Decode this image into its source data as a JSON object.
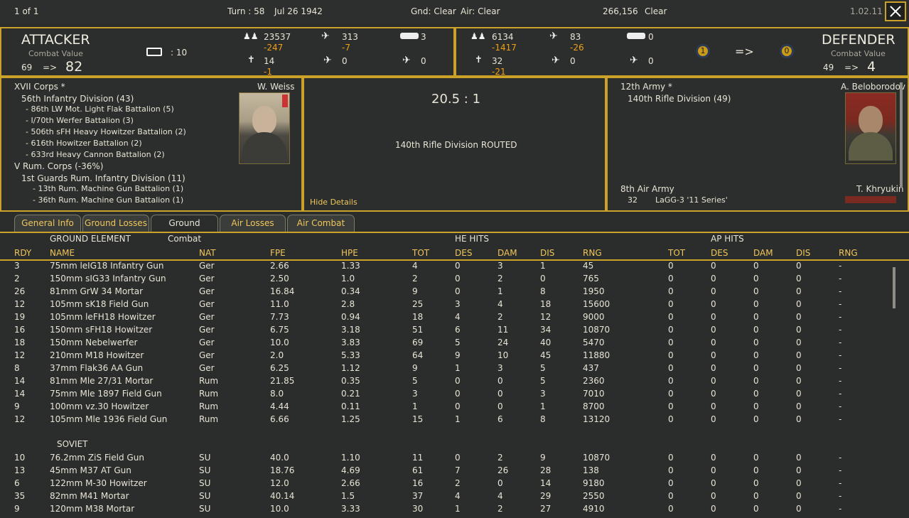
{
  "topbar": {
    "page": "1 of 1",
    "turn": "Turn : 58",
    "date": "Jul 26 1942",
    "gnd": "Gnd: Clear",
    "air": "Air: Clear",
    "hex": "266,156",
    "terrain": "Clear",
    "version": "1.02.11"
  },
  "attacker": {
    "title": "ATTACKER",
    "cv_label": "Combat Value",
    "cv_from": "69",
    "arrow": "=>",
    "cv_to": "82",
    "fort_value": ": 10",
    "men": "23537",
    "men_loss": "-247",
    "planes": "313",
    "planes_loss": "-7",
    "tanks": "3",
    "guns": "14",
    "guns_loss": "-1",
    "fighters": "0",
    "bombers": "0"
  },
  "defender": {
    "title": "DEFENDER",
    "cv_label": "Combat Value",
    "cv_from": "49",
    "arrow": "=>",
    "cv_to": "4",
    "men": "6134",
    "men_loss": "-1417",
    "planes": "83",
    "planes_loss": "-26",
    "tanks": "0",
    "guns": "32",
    "guns_loss": "-21",
    "fighters": "0",
    "bombers": "0",
    "badge_left": "1",
    "badge_arrow": "=>",
    "badge_right": "0"
  },
  "attacker_units": {
    "corps": "XVII Corps *",
    "commander": "W. Weiss",
    "division": "56th Infantry Division (43)",
    "attachments": [
      "- 86th LW Mot. Light Flak Battalion (5)",
      "- I/70th Werfer Battalion (3)",
      "- 506th sFH Heavy Howitzer Battalion (2)",
      "- 616th Howitzer Battalion (2)",
      "- 633rd Heavy Cannon Battalion (2)"
    ],
    "corps2": "V Rum. Corps (-36%)",
    "division2": "1st Guards Rum. Infantry Division (11)",
    "attachments2": [
      "- 13th Rum. Machine Gun Battalion (1)",
      "- 36th Rum. Machine Gun Battalion (1)"
    ]
  },
  "result": {
    "odds": "20.5 : 1",
    "outcome": "140th Rifle Division ROUTED",
    "hide": "Hide Details"
  },
  "defender_units": {
    "army": "12th Army *",
    "commander": "A. Beloborodov",
    "division": "140th Rifle Division (49)",
    "air_army": "8th Air Army",
    "air_commander": "T. Khryukin",
    "air_count": "32",
    "air_type": "LaGG-3 '11 Series'"
  },
  "tabs": [
    "General Info",
    "Ground Losses",
    "Ground Combat",
    "Air Losses",
    "Air Combat"
  ],
  "table": {
    "group_ground": "GROUND ELEMENT",
    "group_he": "HE HITS",
    "group_ap": "AP HITS",
    "columns": [
      "RDY",
      "NAME",
      "NAT",
      "FPE",
      "HPE",
      "TOT",
      "DES",
      "DAM",
      "DIS",
      "RNG",
      "TOT",
      "DES",
      "DAM",
      "DIS",
      "RNG"
    ],
    "rows_axis": [
      [
        "3",
        "75mm leIG18 Infantry Gun",
        "Ger",
        "2.66",
        "1.33",
        "4",
        "0",
        "3",
        "1",
        "45",
        "0",
        "0",
        "0",
        "0",
        "-"
      ],
      [
        "2",
        "150mm sIG33 Infantry Gun",
        "Ger",
        "2.50",
        "1.0",
        "2",
        "0",
        "2",
        "0",
        "765",
        "0",
        "0",
        "0",
        "0",
        "-"
      ],
      [
        "26",
        "81mm GrW 34 Mortar",
        "Ger",
        "16.84",
        "0.34",
        "9",
        "0",
        "1",
        "8",
        "1950",
        "0",
        "0",
        "0",
        "0",
        "-"
      ],
      [
        "12",
        "105mm sK18 Field Gun",
        "Ger",
        "11.0",
        "2.8",
        "25",
        "3",
        "4",
        "18",
        "15600",
        "0",
        "0",
        "0",
        "0",
        "-"
      ],
      [
        "19",
        "105mm leFH18 Howitzer",
        "Ger",
        "7.73",
        "0.94",
        "18",
        "4",
        "2",
        "12",
        "9000",
        "0",
        "0",
        "0",
        "0",
        "-"
      ],
      [
        "16",
        "150mm sFH18 Howitzer",
        "Ger",
        "6.75",
        "3.18",
        "51",
        "6",
        "11",
        "34",
        "10870",
        "0",
        "0",
        "0",
        "0",
        "-"
      ],
      [
        "18",
        "150mm Nebelwerfer",
        "Ger",
        "10.0",
        "3.83",
        "69",
        "5",
        "24",
        "40",
        "5470",
        "0",
        "0",
        "0",
        "0",
        "-"
      ],
      [
        "12",
        "210mm M18 Howitzer",
        "Ger",
        "2.0",
        "5.33",
        "64",
        "9",
        "10",
        "45",
        "11880",
        "0",
        "0",
        "0",
        "0",
        "-"
      ],
      [
        "8",
        "37mm Flak36 AA Gun",
        "Ger",
        "6.25",
        "1.12",
        "9",
        "1",
        "3",
        "5",
        "437",
        "0",
        "0",
        "0",
        "0",
        "-"
      ],
      [
        "14",
        "81mm Mle 27/31 Mortar",
        "Rum",
        "21.85",
        "0.35",
        "5",
        "0",
        "0",
        "5",
        "2360",
        "0",
        "0",
        "0",
        "0",
        "-"
      ],
      [
        "14",
        "75mm Mle 1897 Field Gun",
        "Rum",
        "8.0",
        "0.21",
        "3",
        "0",
        "0",
        "3",
        "7010",
        "0",
        "0",
        "0",
        "0",
        "-"
      ],
      [
        "9",
        "100mm vz.30 Howitzer",
        "Rum",
        "4.44",
        "0.11",
        "1",
        "0",
        "0",
        "1",
        "8700",
        "0",
        "0",
        "0",
        "0",
        "-"
      ],
      [
        "12",
        "105mm Mle 1936 Field Gun",
        "Rum",
        "6.66",
        "1.25",
        "15",
        "1",
        "6",
        "8",
        "13120",
        "0",
        "0",
        "0",
        "0",
        "-"
      ]
    ],
    "soviet_label": "SOVIET",
    "rows_soviet": [
      [
        "10",
        "76.2mm ZiS Field Gun",
        "SU",
        "40.0",
        "1.10",
        "11",
        "0",
        "2",
        "9",
        "10870",
        "0",
        "0",
        "0",
        "0",
        "-"
      ],
      [
        "13",
        "45mm M37 AT Gun",
        "SU",
        "18.76",
        "4.69",
        "61",
        "7",
        "26",
        "28",
        "138",
        "0",
        "0",
        "0",
        "0",
        "-"
      ],
      [
        "6",
        "122mm M-30 Howitzer",
        "SU",
        "12.0",
        "2.66",
        "16",
        "2",
        "0",
        "14",
        "9180",
        "0",
        "0",
        "0",
        "0",
        "-"
      ],
      [
        "35",
        "82mm M41 Mortar",
        "SU",
        "40.14",
        "1.5",
        "37",
        "4",
        "4",
        "29",
        "2550",
        "0",
        "0",
        "0",
        "0",
        "-"
      ],
      [
        "9",
        "120mm M38 Mortar",
        "SU",
        "10.0",
        "3.33",
        "30",
        "1",
        "2",
        "27",
        "4910",
        "0",
        "0",
        "0",
        "0",
        "-"
      ]
    ]
  },
  "colors": {
    "accent": "#c9a227",
    "loss": "#f0a012",
    "header": "#f0c65a",
    "bg": "#2a2d2b"
  }
}
